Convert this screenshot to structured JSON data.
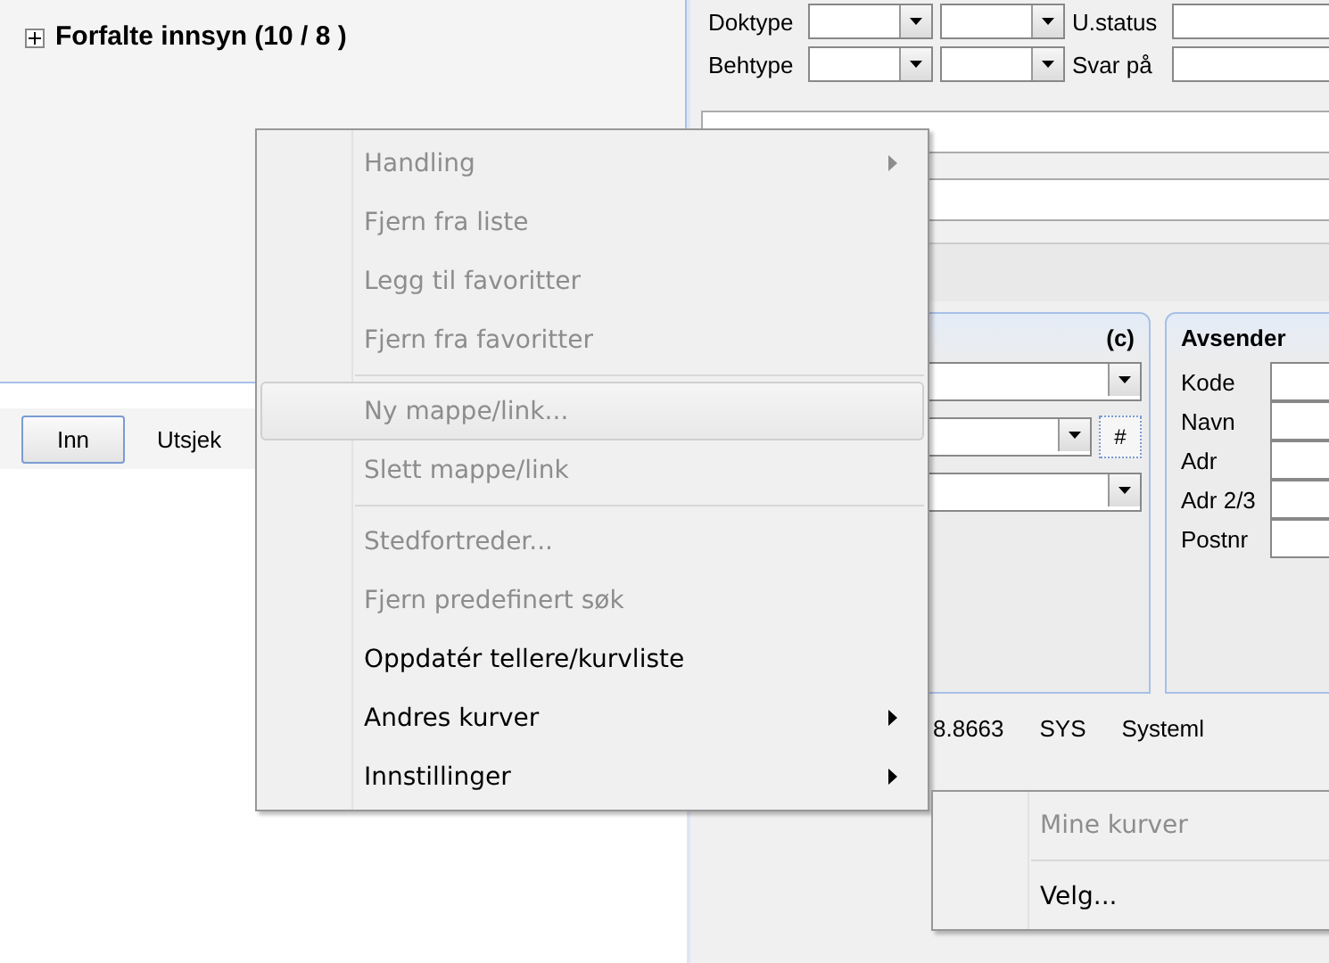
{
  "tree": {
    "label": "Forfalte innsyn (10 / 8 )",
    "expanded": false
  },
  "filter_rows": [
    {
      "fields": [
        {
          "label": "Doktype"
        },
        {
          "label": "U.status"
        }
      ]
    },
    {
      "fields": [
        {
          "label": "Behtype"
        },
        {
          "label": "Svar på"
        }
      ]
    }
  ],
  "inn_button": "Inn",
  "utsjek_label": "Utsjek",
  "panel_c": {
    "title": "(c)",
    "hash_button": "#"
  },
  "avsender": {
    "title": "Avsender",
    "fields": [
      "Kode",
      "Navn",
      "Adr",
      "Adr 2/3",
      "Postnr"
    ]
  },
  "list_row": [
    "8.8663",
    "SYS",
    "Systeml"
  ],
  "context_menu": {
    "items": [
      {
        "kind": "item",
        "label": "Handling",
        "disabled": true,
        "submenu": true,
        "selected": false
      },
      {
        "kind": "item",
        "label": "Fjern fra liste",
        "disabled": true,
        "submenu": false,
        "selected": false
      },
      {
        "kind": "item",
        "label": "Legg til favoritter",
        "disabled": true,
        "submenu": false,
        "selected": false
      },
      {
        "kind": "item",
        "label": "Fjern fra favoritter",
        "disabled": true,
        "submenu": false,
        "selected": false
      },
      {
        "kind": "separator"
      },
      {
        "kind": "item",
        "label": "Ny mappe/link...",
        "disabled": true,
        "submenu": false,
        "selected": true
      },
      {
        "kind": "item",
        "label": "Slett mappe/link",
        "disabled": true,
        "submenu": false,
        "selected": false
      },
      {
        "kind": "separator"
      },
      {
        "kind": "item",
        "label": "Stedfortreder...",
        "disabled": true,
        "submenu": false,
        "selected": false
      },
      {
        "kind": "item",
        "label": "Fjern predefinert søk",
        "disabled": true,
        "submenu": false,
        "selected": false
      },
      {
        "kind": "item",
        "label": "Oppdatér tellere/kurvliste",
        "disabled": false,
        "submenu": false,
        "selected": false
      },
      {
        "kind": "item",
        "label": "Andres kurver",
        "disabled": false,
        "submenu": true,
        "selected": false
      },
      {
        "kind": "item",
        "label": "Innstillinger",
        "disabled": false,
        "submenu": true,
        "selected": false
      }
    ]
  },
  "submenu": {
    "items": [
      {
        "kind": "item",
        "label": "Mine kurver",
        "disabled": true,
        "submenu": false,
        "selected": false
      },
      {
        "kind": "separator"
      },
      {
        "kind": "item",
        "label": "Velg...",
        "disabled": false,
        "submenu": false,
        "selected": false
      }
    ]
  }
}
